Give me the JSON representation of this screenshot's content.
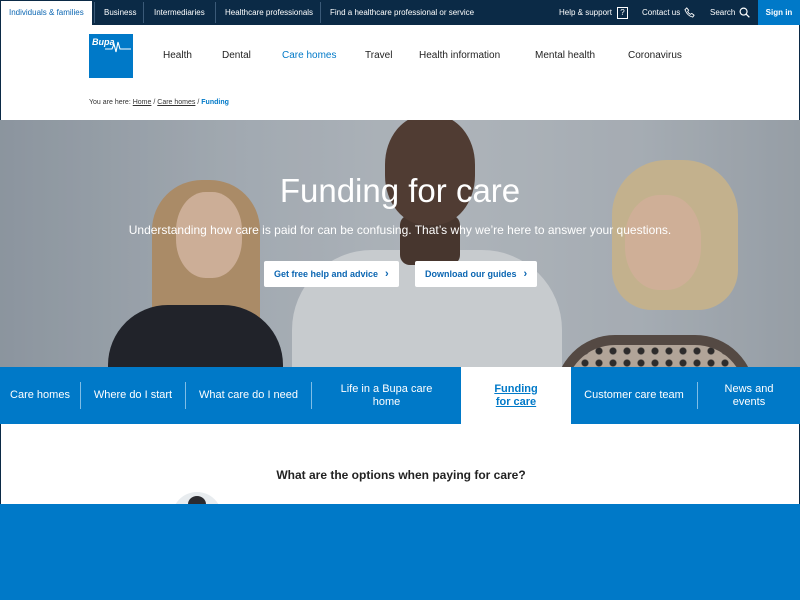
{
  "topbar": {
    "tabs": [
      "Individuals & families",
      "Business",
      "Intermediaries",
      "Healthcare professionals",
      "Find a healthcare professional or service"
    ],
    "help": "Help & support",
    "help_icon": "?",
    "contact": "Contact us",
    "search": "Search",
    "signin": "Sign in"
  },
  "header": {
    "logo_text": "Bupa",
    "nav": [
      "Health",
      "Dental",
      "Care homes",
      "Travel",
      "Health information",
      "Mental health",
      "Coronavirus"
    ],
    "active_nav": "Care homes"
  },
  "breadcrumb": {
    "prefix": "You are here:",
    "items": [
      "Home",
      "Care homes",
      "Funding"
    ],
    "separator": "/"
  },
  "hero": {
    "title": "Funding for care",
    "subtitle": "Understanding how care is paid for can be confusing. That’s why we’re here to answer your questions.",
    "buttons": [
      "Get free help and advice",
      "Download our guides"
    ],
    "chevron": "›"
  },
  "section_nav": {
    "tabs": [
      "Care homes",
      "Where do I start",
      "What care do I need",
      "Life in a Bupa care home",
      "Funding for care",
      "Customer care team",
      "News and events"
    ],
    "active": "Funding for care"
  },
  "content": {
    "heading": "What are the options when paying for care?"
  },
  "colors": {
    "brand_blue": "#0079c8",
    "topbar_navy": "#0b2a46"
  }
}
